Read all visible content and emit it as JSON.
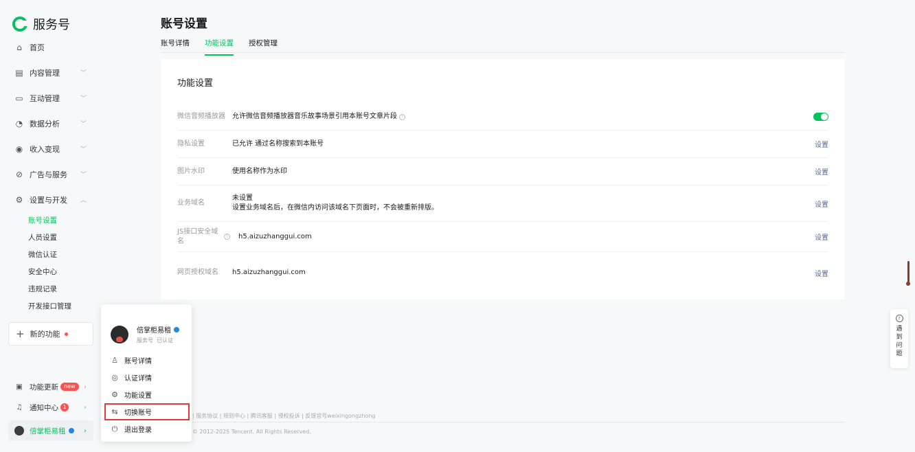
{
  "brand": {
    "name": "服务号",
    "color": "#07c160"
  },
  "sidebar": {
    "items": [
      {
        "icon": "home-icon",
        "label": "首页",
        "chevron": false
      },
      {
        "icon": "document-icon",
        "label": "内容管理",
        "chevron": true
      },
      {
        "icon": "chat-icon",
        "label": "互动管理",
        "chevron": true
      },
      {
        "icon": "analytics-icon",
        "label": "数据分析",
        "chevron": true
      },
      {
        "icon": "income-icon",
        "label": "收入变现",
        "chevron": true
      },
      {
        "icon": "ads-icon",
        "label": "广告与服务",
        "chevron": true
      },
      {
        "icon": "settings-icon",
        "label": "设置与开发",
        "chevron": true
      }
    ],
    "sub_items": [
      "账号设置",
      "人员设置",
      "微信认证",
      "安全中心",
      "违规记录",
      "开发接口管理"
    ],
    "active_sub": "账号设置",
    "new_function": "新的功能",
    "bottom": {
      "updates": {
        "label": "功能更新",
        "badge": "new"
      },
      "notifications": {
        "label": "通知中心",
        "badge": "1"
      },
      "account": {
        "label": "倍掌柜易租"
      }
    }
  },
  "header": {
    "title": "账号设置",
    "tabs": [
      {
        "label": "账号详情",
        "active": false
      },
      {
        "label": "功能设置",
        "active": true
      },
      {
        "label": "授权管理",
        "active": false
      }
    ]
  },
  "card": {
    "title": "功能设置",
    "rows": [
      {
        "label": "微信音频播放器",
        "value": "允许微信音频播放器音乐故事场景引用本账号文章片段",
        "value2": "",
        "help": true,
        "action": "",
        "toggle": true
      },
      {
        "label": "隐私设置",
        "value": "已允许 通过名称搜索到本账号",
        "value2": "",
        "help": false,
        "action": "设置",
        "toggle": false
      },
      {
        "label": "图片水印",
        "value": "使用名称作为水印",
        "value2": "",
        "help": false,
        "action": "设置",
        "toggle": false
      },
      {
        "label": "业务域名",
        "value": "未设置",
        "value2": "设置业务域名后，在微信内访问该域名下页面时，不会被重新排版。",
        "help": false,
        "action": "设置",
        "toggle": false
      },
      {
        "label": "JS接口安全域名",
        "value": "h5.aizuzhanggui.com",
        "value2": "",
        "help": true,
        "action": "设置",
        "toggle": false
      },
      {
        "label": "网页授权域名",
        "value": "h5.aizuzhanggui.com",
        "value2": "",
        "help": false,
        "action": "设置",
        "toggle": false
      }
    ]
  },
  "footer": {
    "links": "|  服务协议  |  规则中心  |  腾讯客服  |  侵权投诉  |  反馈官号weixingongzhong",
    "copyright": "© 2012-2025 Tencent. All Rights Reserved."
  },
  "popup": {
    "name": "倍掌柜易租",
    "type": "服务号",
    "status": "已认证",
    "items": [
      {
        "icon": "user-icon",
        "label": "账号详情",
        "highlight": false
      },
      {
        "icon": "verified-icon",
        "label": "认证详情",
        "highlight": false
      },
      {
        "icon": "gear-icon",
        "label": "功能设置",
        "highlight": false
      },
      {
        "icon": "switch-icon",
        "label": "切换账号",
        "highlight": true
      },
      {
        "icon": "power-icon",
        "label": "退出登录",
        "highlight": false
      }
    ]
  },
  "help_widget": {
    "label_chars": [
      "遇",
      "到",
      "问",
      "题"
    ]
  }
}
